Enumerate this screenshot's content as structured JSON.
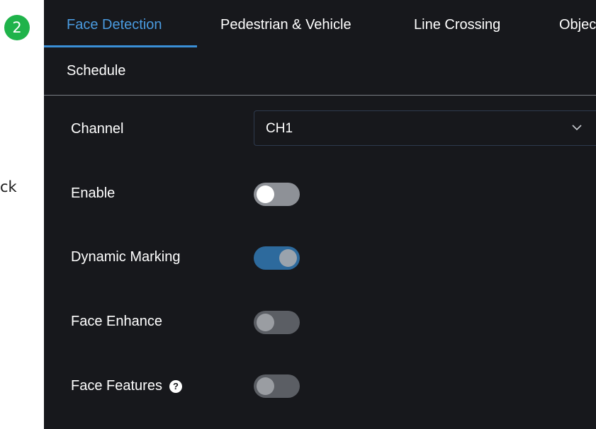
{
  "side_fragment": "ck",
  "step_badge": "2",
  "tabs": [
    {
      "label": "Face Detection",
      "active": true
    },
    {
      "label": "Pedestrian & Vehicle",
      "active": false
    },
    {
      "label": "Line Crossing",
      "active": false
    },
    {
      "label": "Objec",
      "active": false
    },
    {
      "label": "Schedule",
      "active": false
    }
  ],
  "settings": {
    "channel": {
      "label": "Channel",
      "value": "CH1"
    },
    "enable": {
      "label": "Enable",
      "state": "off"
    },
    "dynamic_marking": {
      "label": "Dynamic Marking",
      "state": "on"
    },
    "face_enhance": {
      "label": "Face Enhance",
      "state": "off"
    },
    "face_features": {
      "label": "Face Features",
      "state": "off",
      "help": "?"
    }
  },
  "colors": {
    "panel_bg": "#17181c",
    "accent": "#4a9be0",
    "badge": "#1fb34a",
    "toggle_on": "#2d6a9d"
  }
}
